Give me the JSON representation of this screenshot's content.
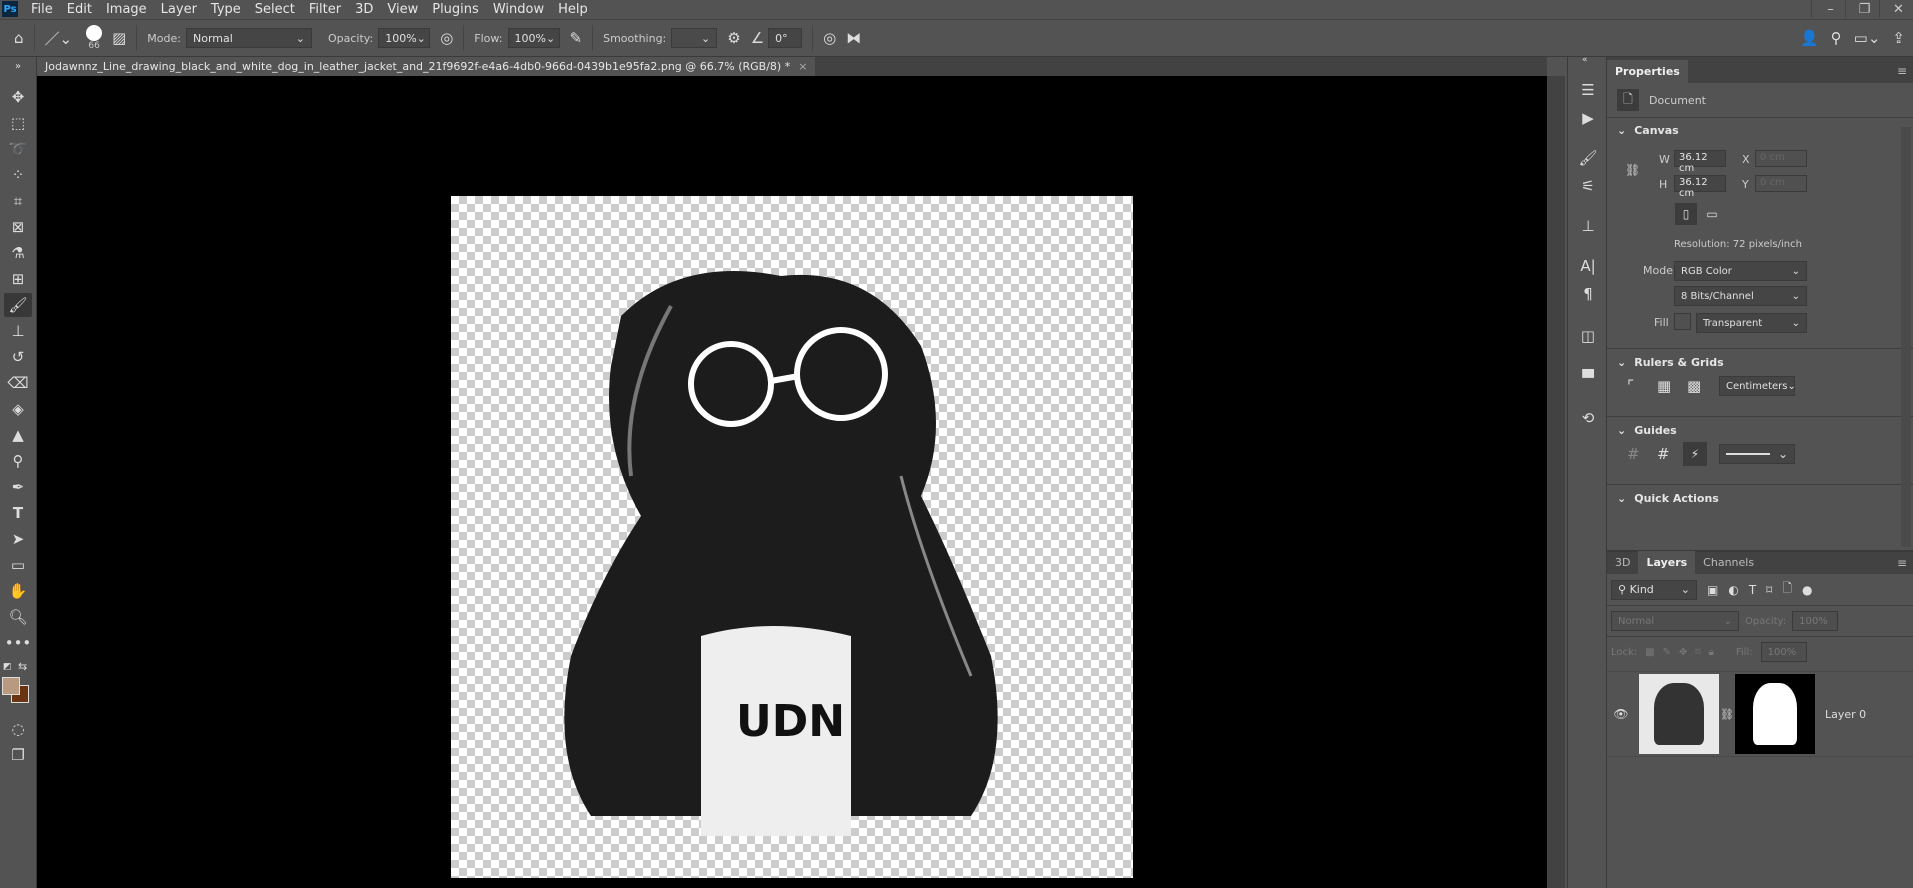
{
  "app": {
    "logo": "Ps",
    "menu": [
      "File",
      "Edit",
      "Image",
      "Layer",
      "Type",
      "Select",
      "Filter",
      "3D",
      "View",
      "Plugins",
      "Window",
      "Help"
    ],
    "window_controls": [
      "minimize-icon",
      "restore-icon",
      "close-icon"
    ]
  },
  "options": {
    "brush_size": "66",
    "mode_label": "Mode:",
    "mode_value": "Normal",
    "opacity_label": "Opacity:",
    "opacity_value": "100%",
    "flow_label": "Flow:",
    "flow_value": "100%",
    "smoothing_label": "Smoothing:",
    "smoothing_value": "",
    "angle_value": "0°"
  },
  "document": {
    "tab_title": "Jodawnnz_Line_drawing_black_and_white_dog_in_leather_jacket_and_21f9692f-e4a6-4db0-966d-0439b1e95fa2.png @ 66.7% (RGB/8) *",
    "close": "×"
  },
  "tools": [
    "move",
    "marquee",
    "lasso",
    "quick-selection",
    "crop",
    "frame",
    "eyedropper",
    "healing",
    "brush",
    "stamp",
    "history-brush",
    "eraser",
    "paint-bucket",
    "blur",
    "dodge",
    "pen",
    "type",
    "path-selection",
    "rectangle",
    "hand",
    "zoom",
    "more"
  ],
  "colors": {
    "foreground": "#b89a80",
    "background": "#6b3410"
  },
  "properties": {
    "tab": "Properties",
    "doc_label": "Document",
    "canvas": {
      "title": "Canvas",
      "w_label": "W",
      "w_value": "36.12 cm",
      "h_label": "H",
      "h_value": "36.12 cm",
      "x_label": "X",
      "x_value": "0 cm",
      "y_label": "Y",
      "y_value": "0 cm",
      "resolution": "Resolution: 72 pixels/inch",
      "mode_label": "Mode",
      "mode_value": "RGB Color",
      "depth_value": "8 Bits/Channel",
      "fill_label": "Fill",
      "fill_value": "Transparent"
    },
    "rulers": {
      "title": "Rulers & Grids",
      "units": "Centimeters"
    },
    "guides": {
      "title": "Guides"
    },
    "quick_actions": {
      "title": "Quick Actions"
    }
  },
  "layers_panel": {
    "tabs": [
      "3D",
      "Layers",
      "Channels"
    ],
    "filter": "Kind",
    "blend": "Normal",
    "opacity_label": "Opacity:",
    "opacity_value": "100%",
    "lock_label": "Lock:",
    "fill_label": "Fill:",
    "fill_value": "100%",
    "layers": [
      {
        "name": "Layer 0",
        "visible": true
      }
    ]
  }
}
